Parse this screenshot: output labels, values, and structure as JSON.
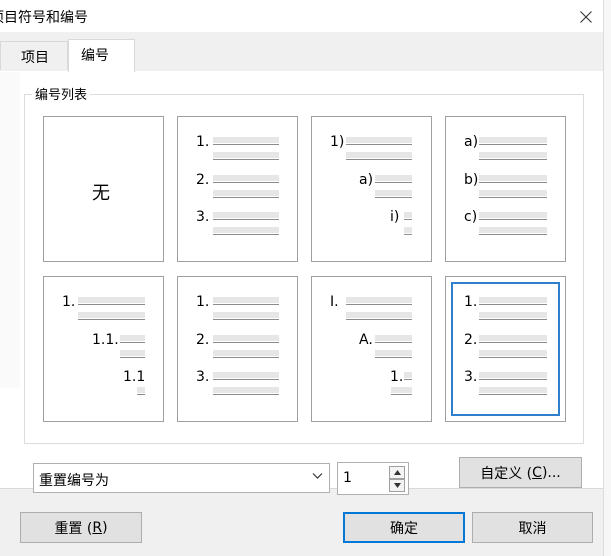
{
  "window": {
    "title": "项目符号和编号",
    "close_icon": "close-icon"
  },
  "tabs": [
    {
      "label": "项目",
      "selected": false
    },
    {
      "label": "编号",
      "selected": true
    }
  ],
  "group": {
    "label": "编号列表"
  },
  "gallery": {
    "selected_index": 7,
    "cells": [
      {
        "kind": "none",
        "label": "无"
      },
      {
        "kind": "list",
        "markers": [
          "1.",
          "2.",
          "3."
        ]
      },
      {
        "kind": "list",
        "markers": [
          "1)",
          "a)",
          "i)"
        ]
      },
      {
        "kind": "list",
        "markers": [
          "a)",
          "b)",
          "c)"
        ]
      },
      {
        "kind": "list",
        "markers": [
          "1.",
          "1.1.",
          "1.1"
        ]
      },
      {
        "kind": "list",
        "markers": [
          "1.",
          "2.",
          "3."
        ]
      },
      {
        "kind": "list",
        "markers": [
          "I.",
          "A.",
          "1."
        ]
      },
      {
        "kind": "list",
        "markers": [
          "1.",
          "2.",
          "3."
        ]
      }
    ]
  },
  "reset_combo": {
    "value": "重置编号为",
    "icon": "chevron-down-icon"
  },
  "spinner": {
    "value": "1",
    "up_icon": "spin-up-icon",
    "down_icon": "spin-down-icon"
  },
  "buttons": {
    "custom": {
      "label": "自定义 (",
      "key": "C",
      "suffix": ")..."
    },
    "reset": {
      "label": "重置 (",
      "key": "R",
      "suffix": ")"
    },
    "ok": {
      "label": "确定"
    },
    "cancel": {
      "label": "取消"
    }
  },
  "colors": {
    "accent": "#0078d7",
    "selection": "#2f7fcf"
  }
}
